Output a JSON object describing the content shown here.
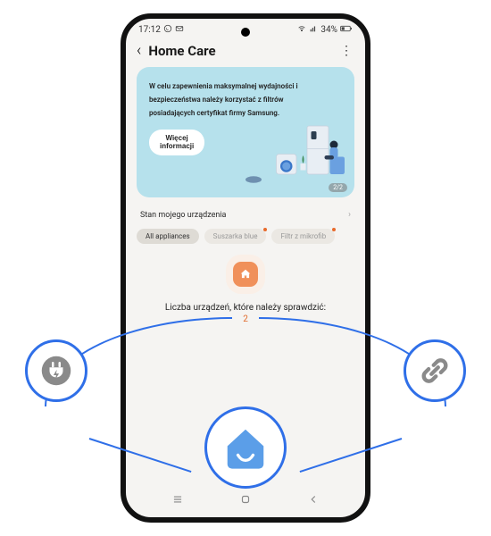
{
  "status": {
    "time": "17:12",
    "battery_text": "34%"
  },
  "header": {
    "title": "Home Care"
  },
  "banner": {
    "text": "W celu zapewnienia maksymalnej wydajności i bezpieczeństwa należy korzystać z filtrów posiadających certyfikat firmy Samsung.",
    "more_label": "Więcej\ninformacji",
    "page": "2/2"
  },
  "device_status": {
    "title": "Stan mojego urządzenia"
  },
  "chips": [
    {
      "label": "All appliances",
      "active": true,
      "dot": false
    },
    {
      "label": "Suszarka blue",
      "active": false,
      "dot": true
    },
    {
      "label": "Filtr z mikrofib",
      "active": false,
      "dot": true
    }
  ],
  "alert": {
    "text": "Liczba urządzeń, które należy sprawdzić:",
    "count": "2"
  },
  "hub": {
    "left_icon": "plug-energy-icon",
    "center_icon": "home-smile-icon",
    "right_icon": "link-icon"
  },
  "colors": {
    "accent": "#2f6fe8",
    "warn": "#e86a2b",
    "banner": "#b6e1ec"
  }
}
